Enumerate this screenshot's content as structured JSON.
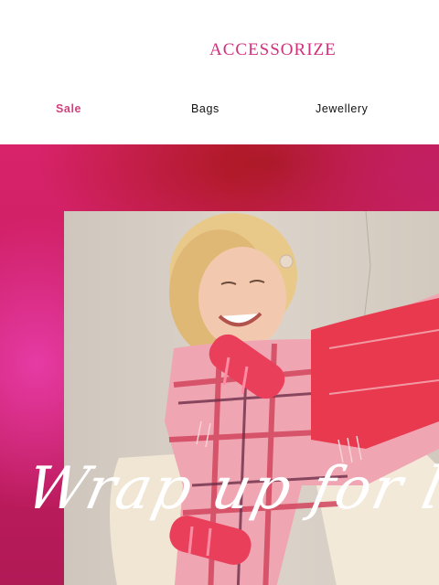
{
  "brand": {
    "logo": "ACCESSORIZE"
  },
  "nav": {
    "items": [
      {
        "label": "Sale"
      },
      {
        "label": "Bags"
      },
      {
        "label": "Jewellery"
      }
    ]
  },
  "hero": {
    "headline": "Wrap up for l",
    "image_desc_icon": "photo-woman-in-plaid-scarf"
  },
  "colors": {
    "brand_pink": "#d0317c",
    "sale_pink": "#d2407f",
    "hero_magenta": "#d8236a"
  }
}
